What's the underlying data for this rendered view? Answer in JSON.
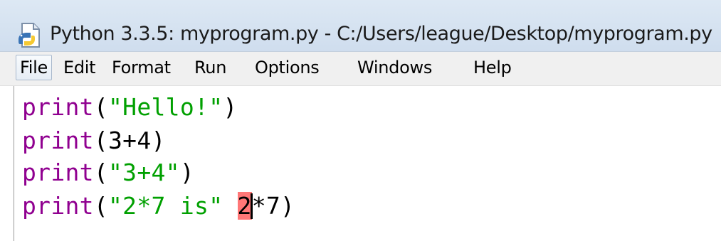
{
  "window": {
    "title": "Python 3.3.5: myprogram.py - C:/Users/league/Desktop/myprogram.py"
  },
  "menubar": {
    "items": [
      "File",
      "Edit",
      "Format",
      "Run",
      "Options",
      "Windows",
      "Help"
    ],
    "active": "File"
  },
  "editor": {
    "lines": [
      {
        "func": "print",
        "open": "(",
        "string": "\"Hello!\"",
        "close": ")"
      },
      {
        "func": "print",
        "open": "(",
        "expr": "3+4",
        "close": ")"
      },
      {
        "func": "print",
        "open": "(",
        "string": "\"3+4\"",
        "close": ")"
      },
      {
        "func": "print",
        "open": "(",
        "string": "\"2*7 is\"",
        "space": " ",
        "error_char": "2",
        "rest": "*7",
        "close": ")"
      }
    ]
  },
  "colors": {
    "keyword": "#900090",
    "string": "#00a000",
    "error_highlight": "#ff7777",
    "titlebar": "#d6e3f1",
    "menubar": "#f0f0f0"
  },
  "icons": {
    "app": "python-idle-icon"
  }
}
